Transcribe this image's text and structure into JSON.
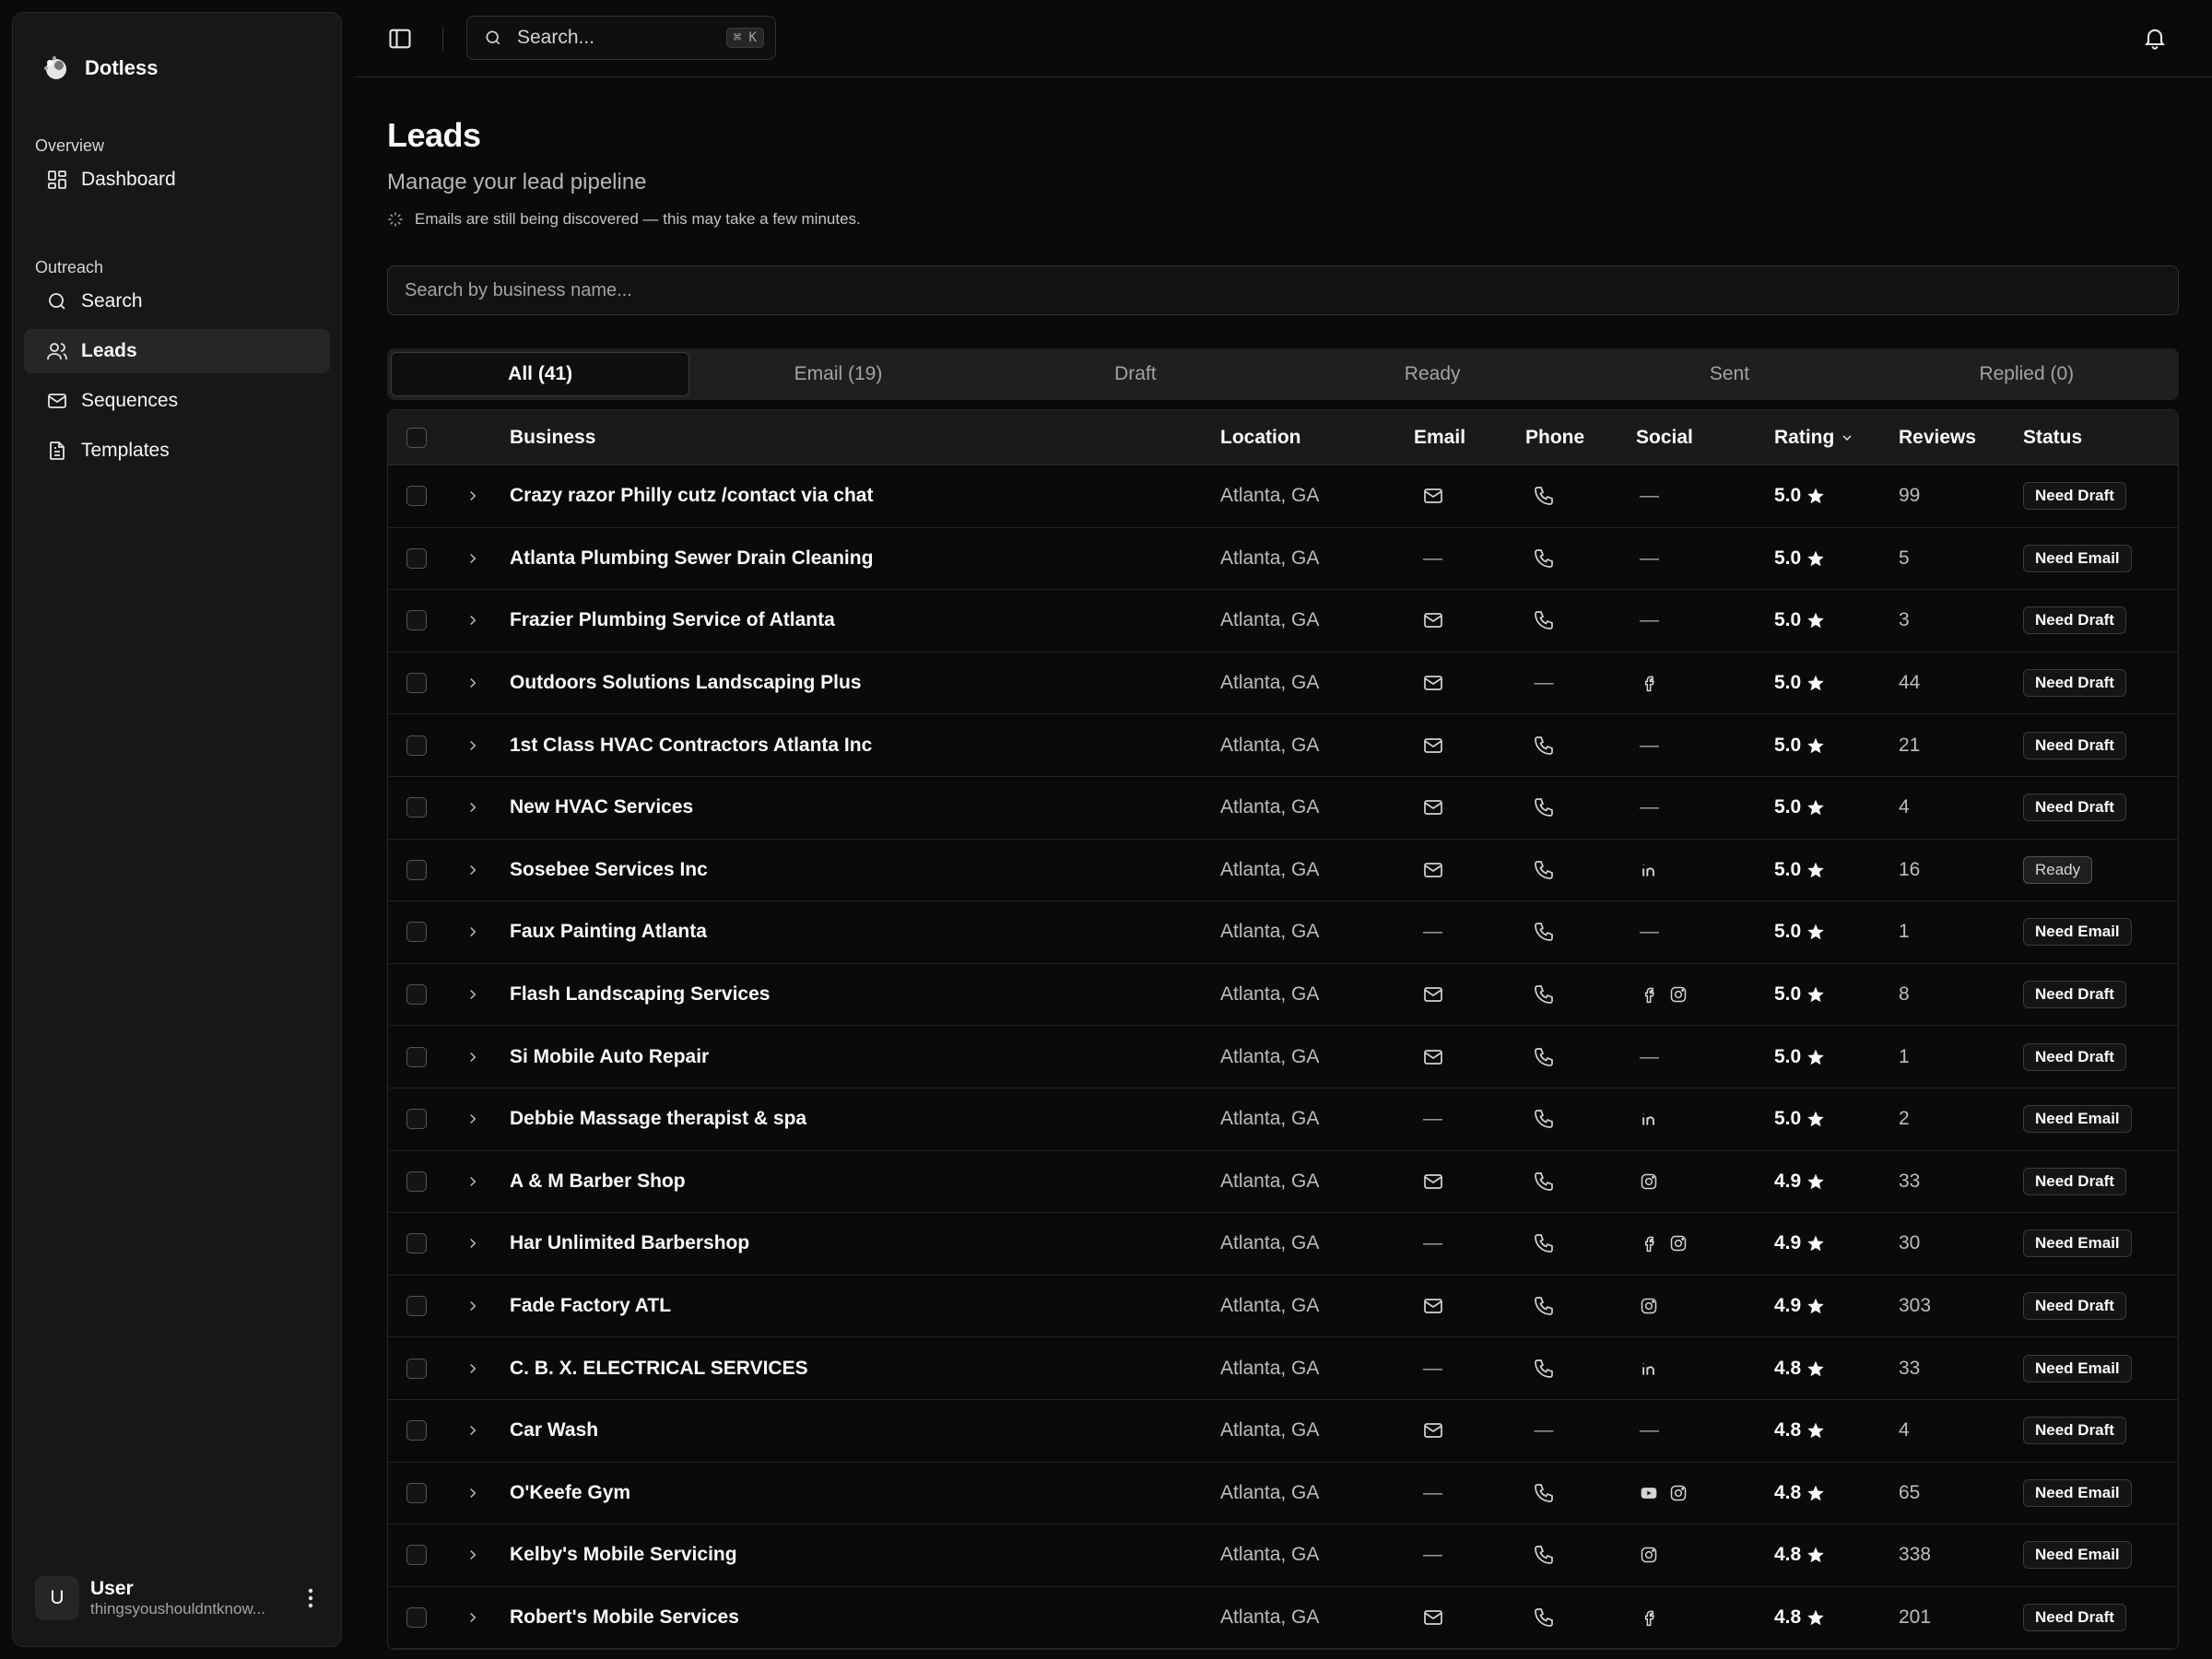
{
  "app": {
    "name": "Dotless"
  },
  "sidebar": {
    "groups": [
      {
        "label": "Overview",
        "items": [
          {
            "label": "Dashboard",
            "icon": "dashboard-icon"
          }
        ]
      },
      {
        "label": "Outreach",
        "items": [
          {
            "label": "Search",
            "icon": "search-icon"
          },
          {
            "label": "Leads",
            "icon": "users-icon",
            "active": true
          },
          {
            "label": "Sequences",
            "icon": "mail-icon"
          },
          {
            "label": "Templates",
            "icon": "file-text-icon"
          }
        ]
      }
    ],
    "user": {
      "initial": "U",
      "name": "User",
      "email": "thingsyoushouldntknow..."
    }
  },
  "topbar": {
    "search_placeholder": "Search...",
    "shortcut": "⌘ K"
  },
  "page": {
    "title": "Leads",
    "subtitle": "Manage your lead pipeline",
    "notice": "Emails are still being discovered — this may take a few minutes.",
    "search_placeholder": "Search by business name..."
  },
  "tabs": [
    "All (41)",
    "Email (19)",
    "Draft",
    "Ready",
    "Sent",
    "Replied (0)"
  ],
  "table": {
    "headers": {
      "business": "Business",
      "location": "Location",
      "email": "Email",
      "phone": "Phone",
      "social": "Social",
      "rating": "Rating",
      "reviews": "Reviews",
      "status": "Status"
    },
    "rows": [
      {
        "business": "Crazy razor Philly cutz /contact via chat",
        "location": "Atlanta, GA",
        "email": true,
        "phone": true,
        "social": [],
        "rating": "5.0",
        "reviews": "99",
        "status": "Need Draft"
      },
      {
        "business": "Atlanta Plumbing Sewer Drain Cleaning",
        "location": "Atlanta, GA",
        "email": false,
        "phone": true,
        "social": [],
        "rating": "5.0",
        "reviews": "5",
        "status": "Need Email"
      },
      {
        "business": "Frazier Plumbing Service of Atlanta",
        "location": "Atlanta, GA",
        "email": true,
        "phone": true,
        "social": [],
        "rating": "5.0",
        "reviews": "3",
        "status": "Need Draft"
      },
      {
        "business": "Outdoors Solutions Landscaping Plus",
        "location": "Atlanta, GA",
        "email": true,
        "phone": false,
        "social": [
          "facebook"
        ],
        "rating": "5.0",
        "reviews": "44",
        "status": "Need Draft"
      },
      {
        "business": "1st Class HVAC Contractors Atlanta Inc",
        "location": "Atlanta, GA",
        "email": true,
        "phone": true,
        "social": [],
        "rating": "5.0",
        "reviews": "21",
        "status": "Need Draft"
      },
      {
        "business": "New HVAC Services",
        "location": "Atlanta, GA",
        "email": true,
        "phone": true,
        "social": [],
        "rating": "5.0",
        "reviews": "4",
        "status": "Need Draft"
      },
      {
        "business": "Sosebee Services Inc",
        "location": "Atlanta, GA",
        "email": true,
        "phone": true,
        "social": [
          "linkedin"
        ],
        "rating": "5.0",
        "reviews": "16",
        "status": "Ready"
      },
      {
        "business": "Faux Painting Atlanta",
        "location": "Atlanta, GA",
        "email": false,
        "phone": true,
        "social": [],
        "rating": "5.0",
        "reviews": "1",
        "status": "Need Email"
      },
      {
        "business": "Flash Landscaping Services",
        "location": "Atlanta, GA",
        "email": true,
        "phone": true,
        "social": [
          "facebook",
          "instagram"
        ],
        "rating": "5.0",
        "reviews": "8",
        "status": "Need Draft"
      },
      {
        "business": "Si Mobile Auto Repair",
        "location": "Atlanta, GA",
        "email": true,
        "phone": true,
        "social": [],
        "rating": "5.0",
        "reviews": "1",
        "status": "Need Draft"
      },
      {
        "business": "Debbie Massage therapist & spa",
        "location": "Atlanta, GA",
        "email": false,
        "phone": true,
        "social": [
          "linkedin"
        ],
        "rating": "5.0",
        "reviews": "2",
        "status": "Need Email"
      },
      {
        "business": "A & M Barber Shop",
        "location": "Atlanta, GA",
        "email": true,
        "phone": true,
        "social": [
          "instagram"
        ],
        "rating": "4.9",
        "reviews": "33",
        "status": "Need Draft"
      },
      {
        "business": "Har Unlimited Barbershop",
        "location": "Atlanta, GA",
        "email": false,
        "phone": true,
        "social": [
          "facebook",
          "instagram"
        ],
        "rating": "4.9",
        "reviews": "30",
        "status": "Need Email"
      },
      {
        "business": "Fade Factory ATL",
        "location": "Atlanta, GA",
        "email": true,
        "phone": true,
        "social": [
          "instagram"
        ],
        "rating": "4.9",
        "reviews": "303",
        "status": "Need Draft"
      },
      {
        "business": "C. B. X. ELECTRICAL SERVICES",
        "location": "Atlanta, GA",
        "email": false,
        "phone": true,
        "social": [
          "linkedin"
        ],
        "rating": "4.8",
        "reviews": "33",
        "status": "Need Email"
      },
      {
        "business": "Car Wash",
        "location": "Atlanta, GA",
        "email": true,
        "phone": false,
        "social": [],
        "rating": "4.8",
        "reviews": "4",
        "status": "Need Draft"
      },
      {
        "business": "O'Keefe Gym",
        "location": "Atlanta, GA",
        "email": false,
        "phone": true,
        "social": [
          "youtube",
          "instagram"
        ],
        "rating": "4.8",
        "reviews": "65",
        "status": "Need Email"
      },
      {
        "business": "Kelby's Mobile Servicing",
        "location": "Atlanta, GA",
        "email": false,
        "phone": true,
        "social": [
          "instagram"
        ],
        "rating": "4.8",
        "reviews": "338",
        "status": "Need Email"
      },
      {
        "business": "Robert's Mobile Services",
        "location": "Atlanta, GA",
        "email": true,
        "phone": true,
        "social": [
          "facebook"
        ],
        "rating": "4.8",
        "reviews": "201",
        "status": "Need Draft"
      }
    ]
  },
  "empty_dash": "—"
}
